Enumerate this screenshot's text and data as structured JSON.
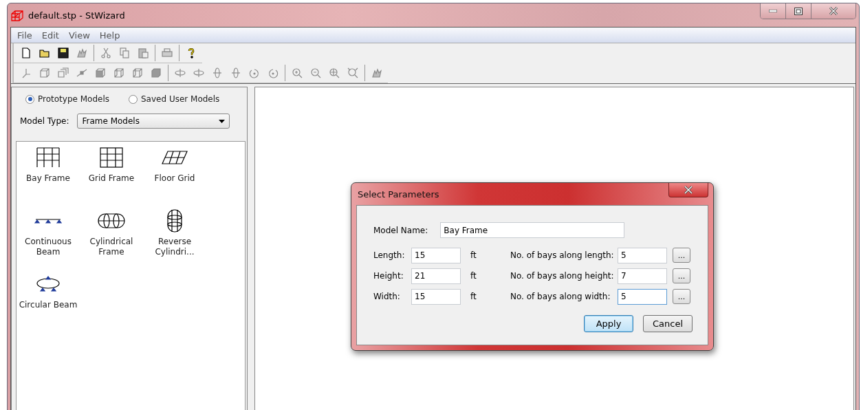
{
  "window": {
    "title": "default.stp - StWizard"
  },
  "menu": [
    "File",
    "Edit",
    "View",
    "Help"
  ],
  "toolbars": [
    {
      "items": [
        {
          "kind": "new",
          "disabled": false
        },
        {
          "kind": "open",
          "disabled": false
        },
        {
          "kind": "save",
          "disabled": false
        },
        {
          "kind": "hand",
          "disabled": true
        },
        {
          "kind": "separator"
        },
        {
          "kind": "cut",
          "disabled": true
        },
        {
          "kind": "copy",
          "disabled": true
        },
        {
          "kind": "paste",
          "disabled": true
        },
        {
          "kind": "separator"
        },
        {
          "kind": "print",
          "disabled": true
        },
        {
          "kind": "separator"
        },
        {
          "kind": "help",
          "disabled": false
        }
      ]
    },
    {
      "items": [
        {
          "kind": "axes",
          "disabled": true
        },
        {
          "kind": "cube",
          "disabled": true
        },
        {
          "kind": "cubes",
          "disabled": true
        },
        {
          "kind": "node",
          "disabled": true
        },
        {
          "kind": "solid-cube",
          "disabled": true
        },
        {
          "kind": "wire-cube",
          "disabled": true
        },
        {
          "kind": "wire-cube",
          "disabled": true
        },
        {
          "kind": "solid-block",
          "disabled": true
        },
        {
          "kind": "separator"
        },
        {
          "kind": "rotate-h",
          "disabled": true
        },
        {
          "kind": "rotate-h",
          "disabled": true
        },
        {
          "kind": "rotate-v",
          "disabled": true
        },
        {
          "kind": "rotate-v",
          "disabled": true
        },
        {
          "kind": "rotate-ccw",
          "disabled": true
        },
        {
          "kind": "rotate-cw",
          "disabled": true
        },
        {
          "kind": "separator"
        },
        {
          "kind": "zoom-in",
          "disabled": true
        },
        {
          "kind": "zoom-out",
          "disabled": true
        },
        {
          "kind": "zoom-fit",
          "disabled": true
        },
        {
          "kind": "zoom-window",
          "disabled": true
        },
        {
          "kind": "separator"
        },
        {
          "kind": "hand",
          "disabled": true
        }
      ]
    }
  ],
  "sidebar": {
    "sources": [
      {
        "label": "Prototype Models",
        "selected": true
      },
      {
        "label": "Saved User Models",
        "selected": false
      }
    ],
    "model_type": {
      "label": "Model Type:",
      "value": "Frame Models"
    },
    "models": [
      {
        "kind": "bay-frame",
        "label": "Bay Frame"
      },
      {
        "kind": "grid-frame",
        "label": "Grid Frame"
      },
      {
        "kind": "floor-grid",
        "label": "Floor Grid"
      },
      {
        "kind": "continuous-beam",
        "label": "Continuous Beam"
      },
      {
        "kind": "cylindrical-frame",
        "label": "Cylindrical Frame"
      },
      {
        "kind": "reverse-cylindrical",
        "label": "Reverse Cylindri..."
      },
      {
        "kind": "circular-beam",
        "label": "Circular Beam"
      }
    ]
  },
  "dialog": {
    "title": "Select Parameters",
    "model_name": {
      "label": "Model Name:",
      "value": "Bay Frame"
    },
    "rows": [
      {
        "label": "Length:",
        "value": "15",
        "unit": "ft",
        "bays_label": "No. of bays along length:",
        "bays_value": "5",
        "bays_focused": false,
        "browse": "..."
      },
      {
        "label": "Height:",
        "value": "21",
        "unit": "ft",
        "bays_label": "No. of bays along height:",
        "bays_value": "7",
        "bays_focused": false,
        "browse": "..."
      },
      {
        "label": "Width:",
        "value": "15",
        "unit": "ft",
        "bays_label": "No. of bays along width:",
        "bays_value": "5",
        "bays_focused": true,
        "browse": "..."
      }
    ],
    "buttons": [
      {
        "label": "Apply",
        "default": true
      },
      {
        "label": "Cancel",
        "default": false
      }
    ]
  }
}
